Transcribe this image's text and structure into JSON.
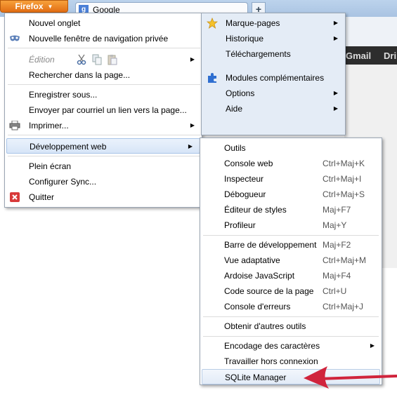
{
  "browser": {
    "firefox_button": "Firefox",
    "tab_title": "Google",
    "tab_icon_letter": "g",
    "new_tab": "+",
    "google_bar": [
      "Gmail",
      "Dri"
    ]
  },
  "main_menu": {
    "left_items": [
      {
        "label": "Nouvel onglet"
      },
      {
        "label": "Nouvelle fenêtre de navigation privée"
      },
      {
        "label": "Édition"
      },
      {
        "label": "Rechercher dans la page..."
      },
      {
        "label": "Enregistrer sous..."
      },
      {
        "label": "Envoyer par courriel un lien vers la page..."
      },
      {
        "label": "Imprimer..."
      },
      {
        "label": "Développement web"
      },
      {
        "label": "Plein écran"
      },
      {
        "label": "Configurer Sync..."
      },
      {
        "label": "Quitter"
      }
    ],
    "right_items": [
      {
        "label": "Marque-pages"
      },
      {
        "label": "Historique"
      },
      {
        "label": "Téléchargements"
      },
      {
        "label": "Modules complémentaires"
      },
      {
        "label": "Options"
      },
      {
        "label": "Aide"
      }
    ]
  },
  "submenu": {
    "items": [
      {
        "label": "Outils",
        "shortcut": ""
      },
      {
        "label": "Console web",
        "shortcut": "Ctrl+Maj+K"
      },
      {
        "label": "Inspecteur",
        "shortcut": "Ctrl+Maj+I"
      },
      {
        "label": "Débogueur",
        "shortcut": "Ctrl+Maj+S"
      },
      {
        "label": "Éditeur de styles",
        "shortcut": "Maj+F7"
      },
      {
        "label": "Profileur",
        "shortcut": "Maj+Y"
      },
      {
        "label": "Barre de développement",
        "shortcut": "Maj+F2"
      },
      {
        "label": "Vue adaptative",
        "shortcut": "Ctrl+Maj+M"
      },
      {
        "label": "Ardoise JavaScript",
        "shortcut": "Maj+F4"
      },
      {
        "label": "Code source de la page",
        "shortcut": "Ctrl+U"
      },
      {
        "label": "Console d'erreurs",
        "shortcut": "Ctrl+Maj+J"
      },
      {
        "label": "Obtenir d'autres outils",
        "shortcut": ""
      },
      {
        "label": "Encodage des caractères",
        "shortcut": ""
      },
      {
        "label": "Travailler hors connexion",
        "shortcut": ""
      },
      {
        "label": "SQLite Manager",
        "shortcut": ""
      }
    ]
  },
  "colors": {
    "firefox_orange": "#e8761a",
    "highlight": "#d7e5f7",
    "annotation_arrow": "#d0243c"
  }
}
